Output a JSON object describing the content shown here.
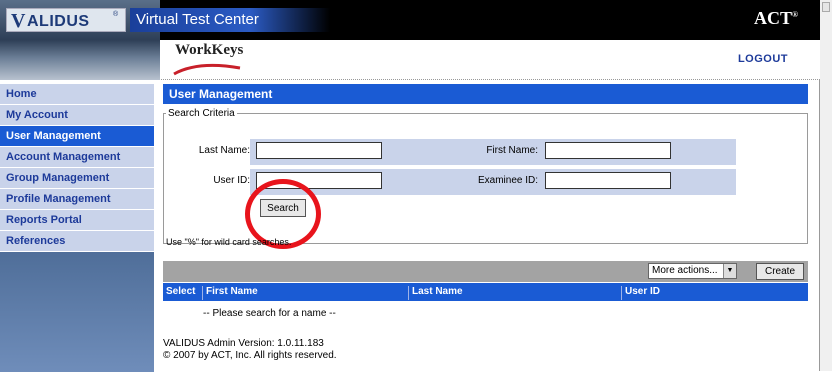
{
  "header": {
    "logo_initial": "V",
    "logo_rest": "ALIDUS",
    "logo_mark": "®",
    "app_title": "Virtual Test Center",
    "corporate_logo": "ACT",
    "corporate_mark": "®",
    "product_logo": "WorkKeys",
    "logout_label": "LOGOUT"
  },
  "nav": {
    "items": [
      {
        "label": "Home",
        "active": false
      },
      {
        "label": "My Account",
        "active": false
      },
      {
        "label": "User Management",
        "active": true
      },
      {
        "label": "Account Management",
        "active": false
      },
      {
        "label": "Group Management",
        "active": false
      },
      {
        "label": "Profile Management",
        "active": false
      },
      {
        "label": "Reports Portal",
        "active": false
      },
      {
        "label": "References",
        "active": false
      }
    ]
  },
  "main": {
    "title": "User Management",
    "search": {
      "legend": "Search Criteria",
      "last_name_label": "Last Name:",
      "first_name_label": "First Name:",
      "user_id_label": "User ID:",
      "examinee_id_label": "Examinee ID:",
      "last_name_value": "",
      "first_name_value": "",
      "user_id_value": "",
      "examinee_id_value": "",
      "search_button": "Search",
      "hint": "Use \"%\" for wild card searches."
    },
    "actions": {
      "select_value": "More actions...",
      "create_button": "Create"
    },
    "results": {
      "columns": [
        "Select",
        "First Name",
        "Last Name",
        "User ID"
      ],
      "empty_message": "-- Please search for a name --"
    }
  },
  "footer": {
    "version": "VALIDUS Admin Version: 1.0.11.183",
    "copyright": "© 2007 by ACT, Inc. All rights reserved."
  },
  "colors": {
    "nav_active": "#1a5bd4",
    "nav_item": "#c9d3ea",
    "header_bar": "#1a5bd4",
    "highlight_circle": "#e8141c"
  }
}
